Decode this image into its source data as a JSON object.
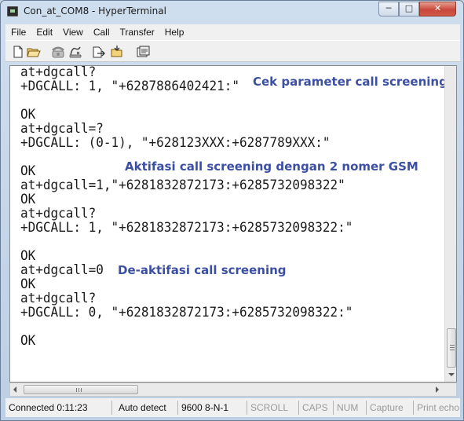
{
  "window": {
    "title": "Con_at_COM8 - HyperTerminal",
    "controls": {
      "minimize": "─",
      "maximize": "□",
      "close": "✕"
    }
  },
  "menu": {
    "items": [
      "File",
      "Edit",
      "View",
      "Call",
      "Transfer",
      "Help"
    ]
  },
  "toolbar": {
    "buttons": [
      "new-icon",
      "open-icon",
      "phone-icon",
      "disconnect-icon",
      "send-icon",
      "receive-icon",
      "properties-icon"
    ]
  },
  "terminal": {
    "lines": [
      "at+dgcall?",
      "+DGCALL: 1, \"+6287886402421:\"",
      "",
      "OK",
      "at+dgcall=?",
      "+DGCALL: (0-1), \"+628123XXX:+6287789XXX:\"",
      "",
      "OK",
      "at+dgcall=1,\"+6281832872173:+6285732098322\"",
      "OK",
      "at+dgcall?",
      "+DGCALL: 1, \"+6281832872173:+6285732098322:\"",
      "",
      "OK",
      "at+dgcall=0",
      "OK",
      "at+dgcall?",
      "+DGCALL: 0, \"+6281832872173:+6285732098322:\"",
      "",
      "OK"
    ],
    "annotations": [
      "Cek parameter call screening",
      "Aktifasi call screening dengan 2 nomer GSM",
      "De-aktifasi call screening"
    ],
    "annotation_color": "#3b4fa3"
  },
  "statusbar": {
    "connected": "Connected 0:11:23",
    "detect": "Auto detect",
    "port_settings": "9600 8-N-1",
    "scroll": "SCROLL",
    "caps": "CAPS",
    "num": "NUM",
    "capture": "Capture",
    "print_echo": "Print echo"
  }
}
